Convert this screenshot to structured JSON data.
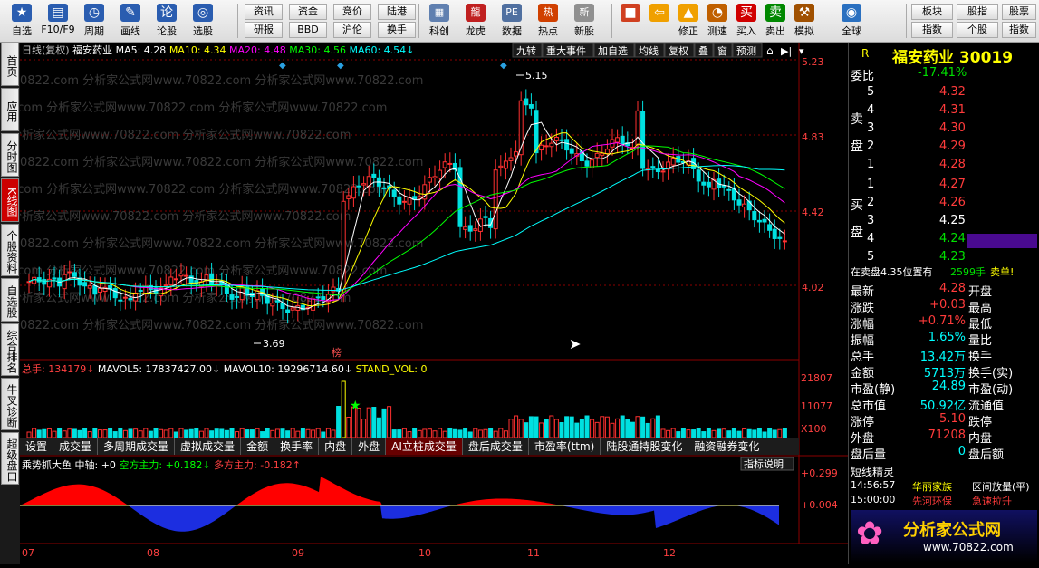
{
  "toolbar": {
    "buttons": [
      {
        "label": "自选",
        "icon": "star-icon",
        "color": "#2a5db0"
      },
      {
        "label": "F10/F9",
        "icon": "doc-icon",
        "color": "#2a5db0"
      },
      {
        "label": "周期",
        "icon": "clock-icon",
        "color": "#2a5db0"
      },
      {
        "label": "画线",
        "icon": "pen-icon",
        "color": "#2a5db0"
      },
      {
        "label": "论股",
        "icon": "chat-icon",
        "color": "#2a5db0"
      },
      {
        "label": "选股",
        "icon": "magnifier-icon",
        "color": "#2a5db0"
      }
    ],
    "small_buttons": [
      "资讯",
      "资金",
      "竞价",
      "陆港",
      "研报",
      "BBD",
      "沪伦",
      "换手"
    ],
    "buttons2": [
      {
        "label": "科创",
        "icon": "chart-icon"
      },
      {
        "label": "龙虎",
        "icon": "dragon-icon"
      },
      {
        "label": "数据",
        "icon": "pe-icon"
      },
      {
        "label": "热点",
        "icon": "hot-icon"
      },
      {
        "label": "新股",
        "icon": "ipo-icon"
      }
    ],
    "buttons3": [
      {
        "label": "",
        "icon": "grid-icon"
      },
      {
        "label": "",
        "icon": "back-arrow-icon"
      },
      {
        "label": "修正",
        "icon": "up-icon"
      },
      {
        "label": "测速",
        "icon": "speed-icon"
      },
      {
        "label": "买入",
        "icon": "buy-icon"
      },
      {
        "label": "卖出",
        "icon": "sell-icon"
      },
      {
        "label": "模拟",
        "icon": "hammer-icon"
      },
      {
        "label": "全球",
        "icon": "globe-icon"
      }
    ],
    "small_buttons2": [
      "板块",
      "股指",
      "指数",
      "个股"
    ]
  },
  "left_tabs": [
    "首页",
    "应用",
    "分时图",
    "K线图",
    "个股资料",
    "自选股",
    "综合排名",
    "牛叉诊断",
    "超级盘口"
  ],
  "chart": {
    "period": "日线(复权)",
    "stock_name": "福安药业",
    "ma_labels": [
      {
        "text": "MA5: 4.28",
        "color": "#ffffff"
      },
      {
        "text": "MA10: 4.34",
        "color": "#ffff00"
      },
      {
        "text": "MA20: 4.48",
        "color": "#ff00ff"
      },
      {
        "text": "MA30: 4.56",
        "color": "#00ff00"
      },
      {
        "text": "MA60: 4.54",
        "color": "#00ffff"
      }
    ],
    "top_buttons": [
      "九转",
      "重大事件",
      "加自选",
      "均线",
      "复权",
      "叠",
      "窗",
      "预测"
    ],
    "price_ticks": [
      "5.23",
      "4.83",
      "4.42",
      "4.02"
    ],
    "high_label": "5.15",
    "low_label": "3.69",
    "bang_label": "榜",
    "watermark": "0822.com 分析家公式网www.70822.com 分析家公式网www.70822.com",
    "volume_header": {
      "total": "总手: 134179",
      "mavol5": "MAVOL5: 17837427.00",
      "mavol10": "MAVOL10: 19296714.60",
      "stand": "STAND_VOL: 0"
    },
    "volume_ticks": [
      "21807",
      "11077",
      "X100"
    ],
    "tabs": [
      "设置",
      "成交量",
      "多周期成交量",
      "虚拟成交量",
      "金额",
      "换手率",
      "内盘",
      "外盘",
      "AI立桩成交量",
      "盘后成交量",
      "市盈率(ttm)",
      "陆股通持股变化",
      "融资融券变化"
    ],
    "active_tab": "AI立桩成交量",
    "indicator": {
      "name": "乘势抓大鱼",
      "mid": "中轴: +0",
      "long": "空方主力: +0.182",
      "short": "多方主力: -0.182",
      "help": "指标说明"
    },
    "indicator_ticks": [
      "+0.299",
      "+0.004"
    ],
    "x_labels": [
      "07",
      "08",
      "09",
      "10",
      "11",
      "12"
    ]
  },
  "right_panel": {
    "code_title": "福安药业 30019",
    "r_label": "R",
    "weibi": {
      "label": "委比",
      "value": "-17.41%"
    },
    "sell": [
      {
        "n": "5",
        "price": "4.32"
      },
      {
        "n": "4",
        "price": "4.31"
      },
      {
        "n": "3",
        "price": "4.30"
      },
      {
        "n": "2",
        "price": "4.29"
      },
      {
        "n": "1",
        "price": "4.28"
      }
    ],
    "buy": [
      {
        "n": "1",
        "price": "4.27"
      },
      {
        "n": "2",
        "price": "4.26"
      },
      {
        "n": "3",
        "price": "4.25"
      },
      {
        "n": "4",
        "price": "4.24"
      },
      {
        "n": "5",
        "price": "4.23"
      }
    ],
    "sell_label": "卖盘",
    "buy_label": "买盘",
    "notice": "在卖盘4.35位置有",
    "notice_qty": "2599手",
    "notice_tag": "卖单!",
    "stats": [
      {
        "l": "最新",
        "v": "4.28",
        "r": "开盘"
      },
      {
        "l": "涨跌",
        "v": "+0.03",
        "r": "最高"
      },
      {
        "l": "涨幅",
        "v": "+0.71%",
        "r": "最低"
      },
      {
        "l": "振幅",
        "v": "1.65%",
        "r": "量比"
      },
      {
        "l": "总手",
        "v": "13.42万",
        "r": "换手"
      },
      {
        "l": "金额",
        "v": "5713万",
        "r": "换手(实)"
      },
      {
        "l": "市盈(静)",
        "v": "24.89",
        "r": "市盈(动)"
      },
      {
        "l": "总市值",
        "v": "50.92亿",
        "r": "流通值"
      },
      {
        "l": "涨停",
        "v": "5.10",
        "r": "跌停"
      },
      {
        "l": "外盘",
        "v": "71208",
        "r": "内盘"
      },
      {
        "l": "盘后量",
        "v": "0",
        "r": "盘后额"
      }
    ],
    "elves_title": "短线精灵",
    "elves": [
      {
        "time": "14:56:57",
        "name": "华丽家族",
        "event": "区间放量(平)"
      },
      {
        "time": "15:00:00",
        "name": "先河环保",
        "event": "急速拉升"
      }
    ],
    "logo_text": "分析家公式网",
    "logo_url": "www.70822.com"
  }
}
